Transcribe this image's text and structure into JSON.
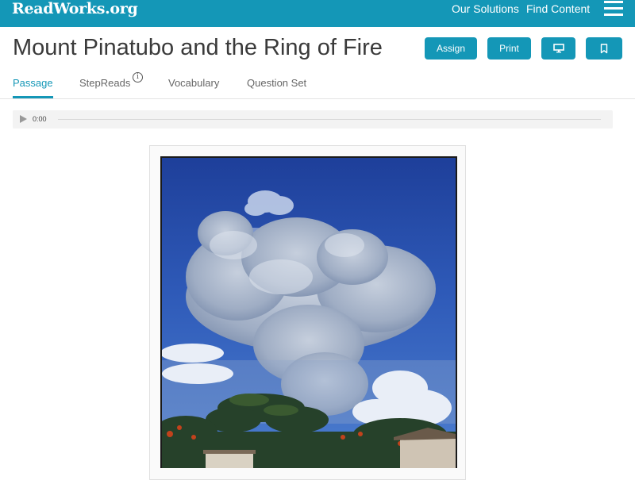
{
  "header": {
    "logo": "ReadWorks.org",
    "nav": [
      "Our Solutions",
      "Find Content"
    ]
  },
  "title": "Mount Pinatubo and the Ring of Fire",
  "actions": {
    "assign": "Assign",
    "print": "Print"
  },
  "tabs": [
    "Passage",
    "StepReads",
    "Vocabulary",
    "Question Set"
  ],
  "audio": {
    "time": "0:00",
    "progress": 0
  },
  "colors": {
    "brand": "#1497b7"
  },
  "icons": {
    "present": "monitor-icon",
    "bookmark": "bookmark-icon",
    "menu": "hamburger-icon",
    "info": "info-icon",
    "play": "play-icon"
  }
}
